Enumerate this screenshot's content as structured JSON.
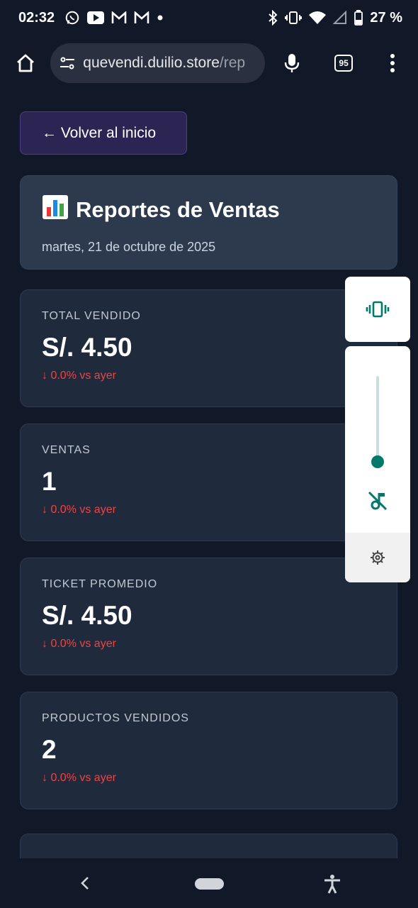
{
  "status_bar": {
    "time": "02:32",
    "battery": "27 %",
    "notification_icons": [
      "whatsapp-icon",
      "youtube-icon",
      "gmail-icon",
      "gmail-icon",
      "dot-icon"
    ],
    "system_icons": [
      "bluetooth-icon",
      "vibrate-icon",
      "wifi-icon",
      "signal-icon",
      "battery-icon"
    ]
  },
  "browser": {
    "url_main": "quevendi.duilio.store",
    "url_rest": "/rep",
    "tabs_count": "95"
  },
  "page": {
    "back_label": "← Volver al inicio",
    "header": {
      "emoji": "📊",
      "title": "Reportes de Ventas",
      "date": "martes, 21 de octubre de 2025"
    },
    "stats": [
      {
        "label": "TOTAL VENDIDO",
        "value": "S/. 4.50",
        "delta": "↓ 0.0% vs ayer"
      },
      {
        "label": "VENTAS",
        "value": "1",
        "delta": "↓ 0.0% vs ayer"
      },
      {
        "label": "TICKET PROMEDIO",
        "value": "S/. 4.50",
        "delta": "↓ 0.0% vs ayer"
      },
      {
        "label": "PRODUCTOS VENDIDOS",
        "value": "2",
        "delta": "↓ 0.0% vs ayer"
      }
    ]
  },
  "colors": {
    "background": "#111827",
    "card": "#1f2a3c",
    "header_card": "#2d3a4e",
    "back_button": "#2c2554",
    "delta_red": "#ef4444",
    "accent_teal": "#00796b"
  }
}
